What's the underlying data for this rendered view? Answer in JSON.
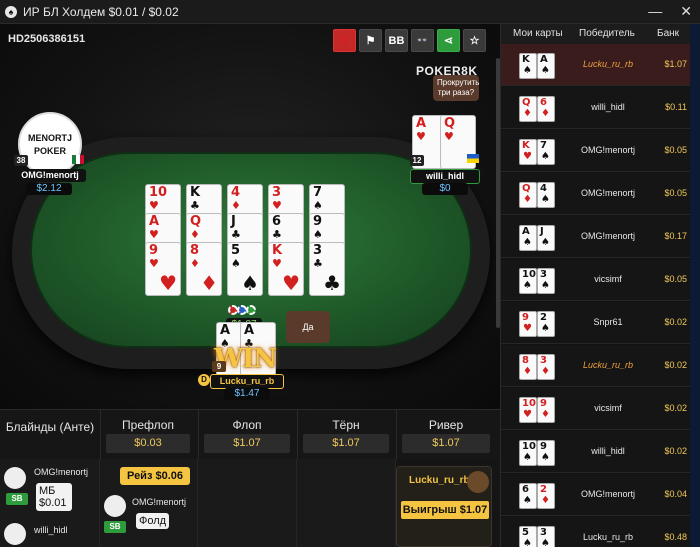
{
  "window": {
    "title": "ИР БЛ Холдем $0.01 / $0.02",
    "minimize": "—",
    "close": "✕",
    "app_icon": "♠"
  },
  "hand_id": "HD2506386151",
  "toolbar": {
    "download": "⬇",
    "report": "⚑",
    "bb": "BB",
    "spy": "👓",
    "share": "⋖",
    "favorite": "☆"
  },
  "logo": "POKER8K",
  "bubbles": {
    "top": "Прокрутить три раза?",
    "bottom": "Да"
  },
  "players": {
    "left": {
      "name": "OMG!menortj",
      "stack": "$2.12",
      "level": "38",
      "avatar_text": "MENORTJ POKER"
    },
    "right": {
      "name": "willi_hidl",
      "stack": "$0",
      "level": "12",
      "cards": [
        {
          "rank": "A",
          "suit": "♥",
          "color": "red"
        },
        {
          "rank": "Q",
          "suit": "♥",
          "color": "red"
        }
      ]
    },
    "hero": {
      "name": "Lucku_ru_rb",
      "stack": "$1.47",
      "level": "9",
      "cards": [
        {
          "rank": "A",
          "suit": "♠",
          "color": "blk"
        },
        {
          "rank": "A",
          "suit": "♣",
          "color": "blk"
        }
      ]
    }
  },
  "win_label": "WIN",
  "pot": "$1.07",
  "board": [
    [
      {
        "rank": "10",
        "suit": "♥",
        "color": "red"
      },
      {
        "rank": "A",
        "suit": "♥",
        "color": "red"
      },
      {
        "rank": "9",
        "suit": "♥",
        "color": "red"
      }
    ],
    [
      {
        "rank": "K",
        "suit": "♣",
        "color": "blk"
      },
      {
        "rank": "Q",
        "suit": "♦",
        "color": "red"
      },
      {
        "rank": "8",
        "suit": "♦",
        "color": "red"
      }
    ],
    [
      {
        "rank": "4",
        "suit": "♦",
        "color": "red"
      },
      {
        "rank": "J",
        "suit": "♣",
        "color": "blk"
      },
      {
        "rank": "5",
        "suit": "♠",
        "color": "blk"
      }
    ],
    [
      {
        "rank": "3",
        "suit": "♥",
        "color": "red"
      },
      {
        "rank": "6",
        "suit": "♣",
        "color": "blk"
      },
      {
        "rank": "K",
        "suit": "♥",
        "color": "red"
      }
    ],
    [
      {
        "rank": "7",
        "suit": "♠",
        "color": "blk"
      },
      {
        "rank": "9",
        "suit": "♠",
        "color": "blk"
      },
      {
        "rank": "3",
        "suit": "♣",
        "color": "blk"
      }
    ]
  ],
  "streets": {
    "blinds": "Блайнды (Анте)",
    "preflop": {
      "label": "Префлоп",
      "value": "$0.03"
    },
    "flop": {
      "label": "Флоп",
      "value": "$1.07"
    },
    "turn": {
      "label": "Тёрн",
      "value": "$1.07"
    },
    "river": {
      "label": "Ривер",
      "value": "$1.07"
    }
  },
  "actions": {
    "p1_name": "OMG!menortj",
    "p1_action": "МБ",
    "p1_amount": "$0.01",
    "p1_pos": "SB",
    "p2_name": "willi_hidl",
    "raise": "Рейз $0.06",
    "fold_name": "OMG!menortj",
    "fold_pos": "SB",
    "fold": "Фолд",
    "winner_name": "Lucku_ru_rb",
    "winner_amount": "Выигрыш $1.07"
  },
  "history": {
    "headers": {
      "cards": "Мои карты",
      "winner": "Победитель",
      "bank": "Банк"
    },
    "rows": [
      {
        "c1": {
          "rank": "K",
          "suit": "♠",
          "color": "blk"
        },
        "c2": {
          "rank": "A",
          "suit": "♠",
          "color": "blk"
        },
        "winner": "Lucku_ru_rb",
        "bank": "$1.07",
        "hl": true,
        "active": true
      },
      {
        "c1": {
          "rank": "Q",
          "suit": "♦",
          "color": "red"
        },
        "c2": {
          "rank": "6",
          "suit": "♦",
          "color": "red"
        },
        "winner": "willi_hidl",
        "bank": "$0.11",
        "hl": false
      },
      {
        "c1": {
          "rank": "K",
          "suit": "♥",
          "color": "red"
        },
        "c2": {
          "rank": "7",
          "suit": "♠",
          "color": "blk"
        },
        "winner": "OMG!menortj",
        "bank": "$0.05",
        "hl": false
      },
      {
        "c1": {
          "rank": "Q",
          "suit": "♦",
          "color": "red"
        },
        "c2": {
          "rank": "4",
          "suit": "♠",
          "color": "blk"
        },
        "winner": "OMG!menortj",
        "bank": "$0.05",
        "hl": false
      },
      {
        "c1": {
          "rank": "A",
          "suit": "♠",
          "color": "blk"
        },
        "c2": {
          "rank": "J",
          "suit": "♠",
          "color": "blk"
        },
        "winner": "OMG!menortj",
        "bank": "$0.17",
        "hl": false
      },
      {
        "c1": {
          "rank": "10",
          "suit": "♠",
          "color": "blk"
        },
        "c2": {
          "rank": "3",
          "suit": "♠",
          "color": "blk"
        },
        "winner": "vicsimf",
        "bank": "$0.05",
        "hl": false
      },
      {
        "c1": {
          "rank": "9",
          "suit": "♥",
          "color": "red"
        },
        "c2": {
          "rank": "2",
          "suit": "♠",
          "color": "blk"
        },
        "winner": "Snpr61",
        "bank": "$0.02",
        "hl": false
      },
      {
        "c1": {
          "rank": "8",
          "suit": "♦",
          "color": "red"
        },
        "c2": {
          "rank": "3",
          "suit": "♦",
          "color": "red"
        },
        "winner": "Lucku_ru_rb",
        "bank": "$0.02",
        "hl": true
      },
      {
        "c1": {
          "rank": "10",
          "suit": "♥",
          "color": "red"
        },
        "c2": {
          "rank": "9",
          "suit": "♦",
          "color": "red"
        },
        "winner": "vicsimf",
        "bank": "$0.02",
        "hl": false
      },
      {
        "c1": {
          "rank": "10",
          "suit": "♠",
          "color": "blk"
        },
        "c2": {
          "rank": "9",
          "suit": "♠",
          "color": "blk"
        },
        "winner": "willi_hidl",
        "bank": "$0.02",
        "hl": false
      },
      {
        "c1": {
          "rank": "6",
          "suit": "♠",
          "color": "blk"
        },
        "c2": {
          "rank": "2",
          "suit": "♦",
          "color": "red"
        },
        "winner": "OMG!menortj",
        "bank": "$0.04",
        "hl": false
      },
      {
        "c1": {
          "rank": "5",
          "suit": "♠",
          "color": "blk"
        },
        "c2": {
          "rank": "3",
          "suit": "♠",
          "color": "blk"
        },
        "winner": "Lucku_ru_rb",
        "bank": "$0.48",
        "hl": false
      }
    ]
  }
}
